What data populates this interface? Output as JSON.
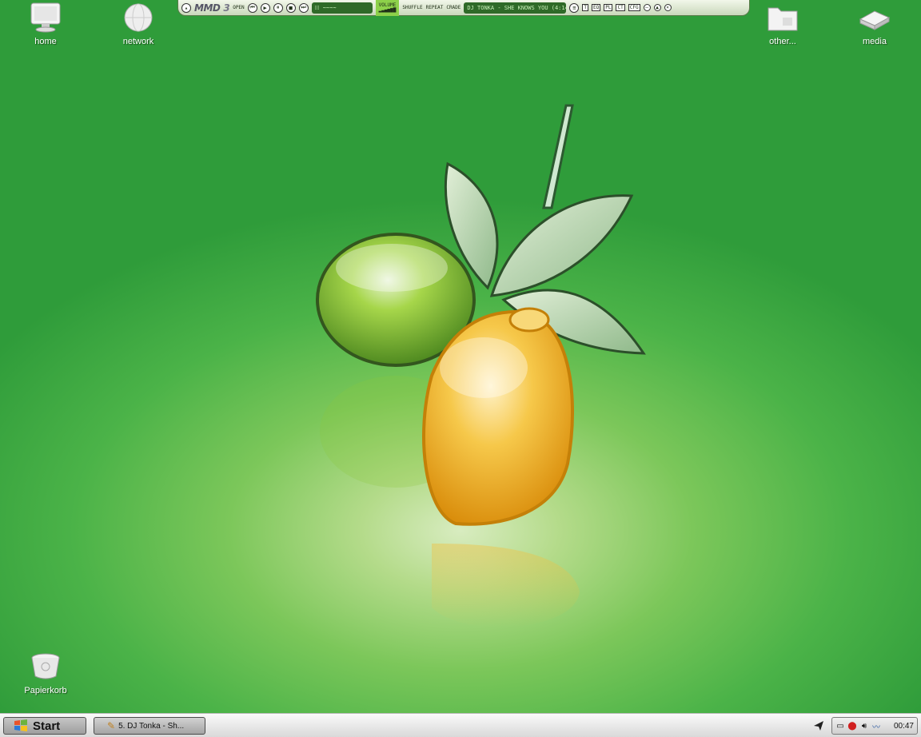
{
  "desktop": {
    "icons": [
      {
        "label": "home"
      },
      {
        "label": "network"
      },
      {
        "label": "other..."
      },
      {
        "label": "media"
      },
      {
        "label": "Papierkorb"
      }
    ]
  },
  "player": {
    "logo": "MMD",
    "logo_version": "3",
    "open_label": "OPEN",
    "volume_label": "VOLUME",
    "shuffle_label": "SHUFFLE",
    "repeat_label": "REPEAT",
    "crade_label": "CRADE",
    "track_display": "DJ TONKA - SHE KNOWS YOU (4:14)",
    "mode_buttons": [
      "T",
      "EQ",
      "PL",
      "CT",
      "CFG"
    ]
  },
  "taskbar": {
    "start_label": "Start",
    "task_label": "5. DJ Tonka - Sh...",
    "clock": "00:47"
  },
  "colors": {
    "desktop_green": "#4bb348",
    "taskbar": "#e9e9e9",
    "lemon": "#f0b020",
    "lime": "#8cc83a"
  }
}
